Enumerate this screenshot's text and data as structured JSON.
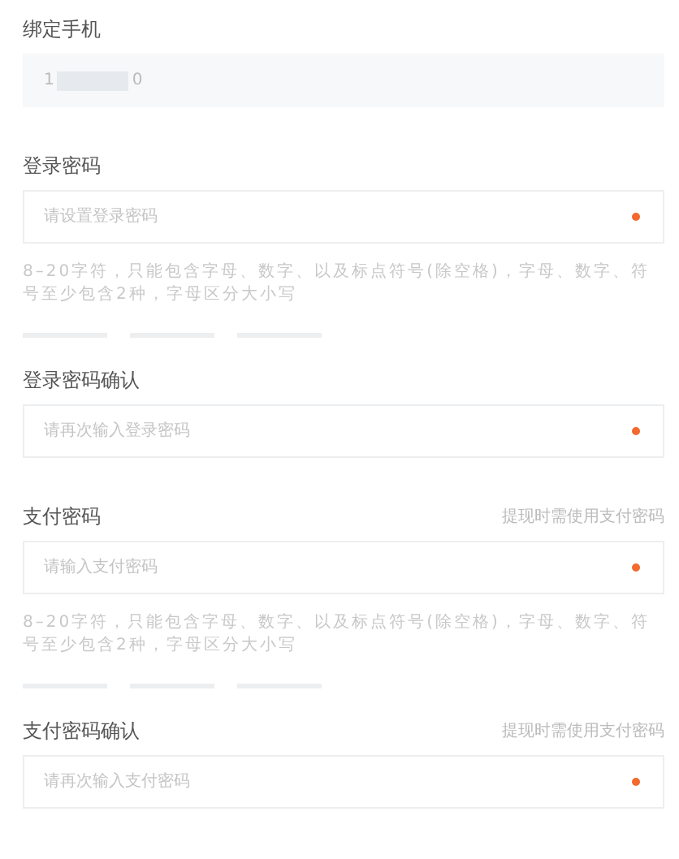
{
  "sections": [
    {
      "kind": "readonly",
      "label": "绑定手机",
      "value_start": "1",
      "value_end": "0",
      "masked": true
    },
    {
      "kind": "password",
      "label": "登录密码",
      "placeholder": "请设置登录密码",
      "required": true,
      "hint": "8–20字符，只能包含字母、数字、以及标点符号(除空格)，字母、数字、符号至少包含2种，字母区分大小写",
      "strength_meter": true
    },
    {
      "kind": "password",
      "label": "登录密码确认",
      "placeholder": "请再次输入登录密码",
      "required": true
    },
    {
      "kind": "password",
      "label": "支付密码",
      "note": "提现时需使用支付密码",
      "placeholder": "请输入支付密码",
      "required": true,
      "hint": "8–20字符，只能包含字母、数字、以及标点符号(除空格)，字母、数字、符号至少包含2种，字母区分大小写",
      "strength_meter": true
    },
    {
      "kind": "password",
      "label": "支付密码确认",
      "note": "提现时需使用支付密码",
      "placeholder": "请再次输入支付密码",
      "required": true
    }
  ]
}
